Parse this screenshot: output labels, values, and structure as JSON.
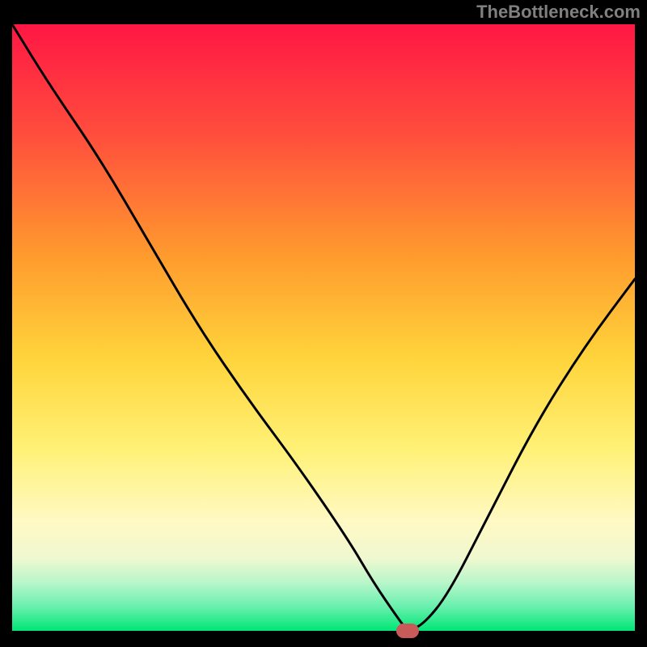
{
  "watermark": "TheBottleneck.com",
  "chart_data": {
    "type": "line",
    "title": "",
    "xlabel": "",
    "ylabel": "",
    "xlim": [
      0,
      100
    ],
    "ylim": [
      0,
      100
    ],
    "gradient_stops": [
      {
        "offset": 0,
        "color": "#ff1744"
      },
      {
        "offset": 18,
        "color": "#ff4d3d"
      },
      {
        "offset": 38,
        "color": "#ff9a2e"
      },
      {
        "offset": 55,
        "color": "#ffd43b"
      },
      {
        "offset": 70,
        "color": "#fff176"
      },
      {
        "offset": 82,
        "color": "#fff9c4"
      },
      {
        "offset": 88,
        "color": "#f0f8d0"
      },
      {
        "offset": 92,
        "color": "#b9f6ca"
      },
      {
        "offset": 96,
        "color": "#69f0ae"
      },
      {
        "offset": 100,
        "color": "#00e676"
      }
    ],
    "series": [
      {
        "name": "bottleneck-curve",
        "x": [
          0,
          6,
          14,
          22,
          30,
          38,
          46,
          54,
          58,
          62,
          63.5,
          66,
          70,
          76,
          84,
          92,
          100
        ],
        "values": [
          100,
          90,
          78,
          64,
          50,
          38,
          27,
          15,
          8,
          2,
          0,
          1,
          6,
          18,
          34,
          47,
          58
        ]
      }
    ],
    "marker": {
      "x": 63.5,
      "y": 0,
      "color": "#c85a5a"
    },
    "legend": []
  }
}
